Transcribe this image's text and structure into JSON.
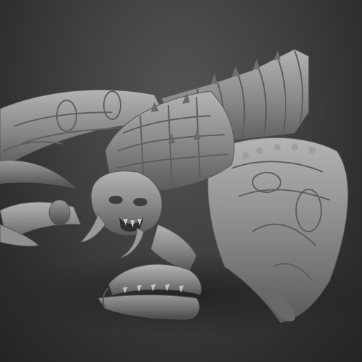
{
  "viewport": {
    "background_color": "#3a3a3a",
    "model_color": "#8c8c8c",
    "subject": "creature-sculpt"
  }
}
